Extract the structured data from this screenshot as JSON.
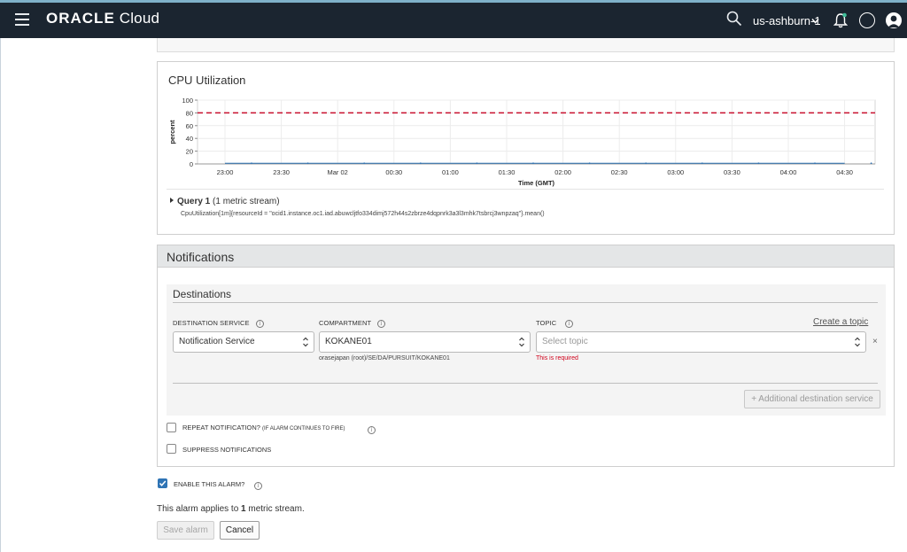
{
  "topbar": {
    "brand_bold": "ORACLE",
    "brand_light": "Cloud",
    "region": "us-ashburn-1",
    "help_glyph": "?"
  },
  "cpu": {
    "title": "CPU Utilization",
    "query_label": "Query 1",
    "query_count": "(1 metric stream)",
    "query_text": "CpuUtilization[1m]{resourceId = \"ocid1.instance.oc1.iad.abuwcljtfo334dimj572h44s2zbrze4dqpnrk3a3l3mhk7tsbrcj3wnpzaq\"}.mean()"
  },
  "chart_data": {
    "type": "line",
    "ylabel": "percent",
    "xlabel": "Time (GMT)",
    "ylim": [
      0,
      100
    ],
    "yticks": [
      "0",
      "20",
      "40",
      "60",
      "80",
      "100"
    ],
    "xticks": [
      "23:00",
      "23:30",
      "Mar 02",
      "00:30",
      "01:00",
      "01:30",
      "02:00",
      "02:30",
      "03:00",
      "03:30",
      "04:00",
      "04:30"
    ],
    "threshold": 80,
    "threshold_color": "#c8102e",
    "series_color": "#2f74b5",
    "grid": true,
    "series": [
      {
        "values": [
          1,
          1,
          1,
          1,
          1,
          1,
          1,
          1,
          1,
          1,
          1,
          1
        ]
      }
    ]
  },
  "notifications": {
    "title": "Notifications",
    "destinations_title": "Destinations",
    "destination_service_label": "DESTINATION SERVICE",
    "destination_service_value": "Notification Service",
    "compartment_label": "COMPARTMENT",
    "compartment_value": "KOKANE01",
    "compartment_path": "orasejapan (root)/SE/DA/PURSUIT/KOKANE01",
    "topic_label": "TOPIC",
    "topic_placeholder": "Select topic",
    "topic_error": "This is required",
    "create_topic": "Create a topic",
    "remove": "×",
    "add_destination": "+ Additional destination service",
    "repeat_label": "REPEAT NOTIFICATION?",
    "repeat_sublabel": "(IF ALARM CONTINUES TO FIRE)",
    "suppress_label": "SUPPRESS NOTIFICATIONS",
    "info_glyph": "i"
  },
  "footer": {
    "enable_label": "ENABLE THIS ALARM?",
    "applies_prefix": "This alarm applies to ",
    "applies_count": "1",
    "applies_suffix": " metric stream.",
    "save_label": "Save alarm",
    "cancel_label": "Cancel"
  }
}
